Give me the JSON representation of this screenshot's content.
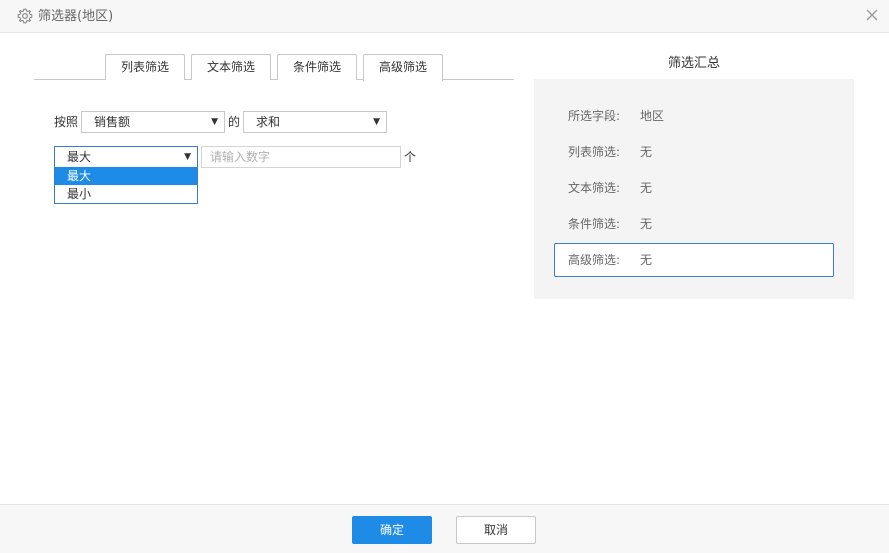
{
  "window": {
    "title": "筛选器(地区)",
    "icon": "gear-icon",
    "close_icon": "close-icon"
  },
  "tabs": [
    {
      "label": "列表筛选"
    },
    {
      "label": "文本筛选"
    },
    {
      "label": "条件筛选"
    },
    {
      "label": "高级筛选",
      "active": true
    }
  ],
  "advanced": {
    "by_label": "按照",
    "field_select": "销售额",
    "of_label": "的",
    "agg_select": "求和",
    "order_select": "最大",
    "number_placeholder": "请输入数字",
    "unit_label": "个",
    "order_options": [
      "最大",
      "最小"
    ]
  },
  "summary": {
    "title": "筛选汇总",
    "rows": [
      {
        "key": "所选字段:",
        "value": "地区"
      },
      {
        "key": "列表筛选:",
        "value": "无"
      },
      {
        "key": "文本筛选:",
        "value": "无"
      },
      {
        "key": "条件筛选:",
        "value": "无"
      },
      {
        "key": "高级筛选:",
        "value": "无"
      }
    ]
  },
  "footer": {
    "confirm": "确定",
    "cancel": "取消"
  },
  "colors": {
    "accent": "#1e8ce6",
    "focus_border": "#3a7bd5",
    "panel_bg": "#f4f4f4"
  }
}
